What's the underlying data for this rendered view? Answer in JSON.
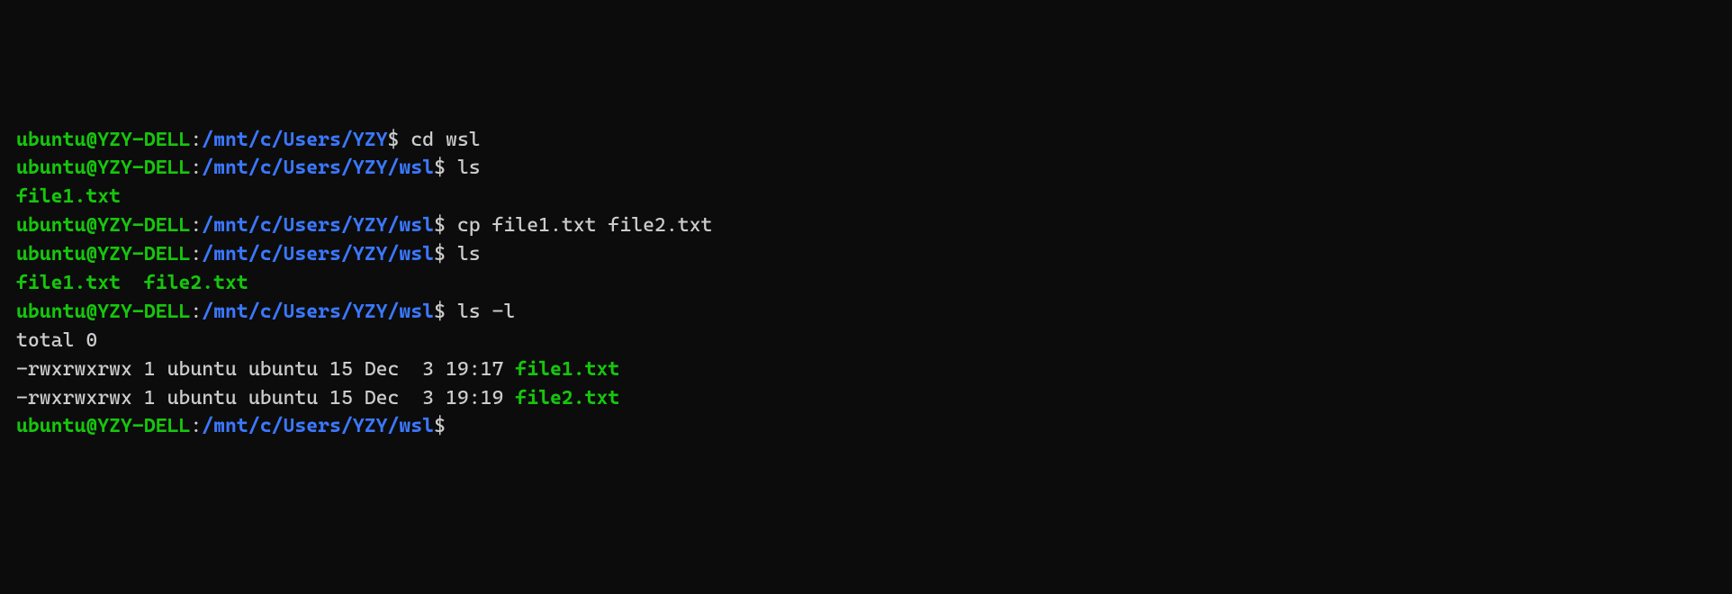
{
  "terminal": {
    "lines": [
      {
        "segments": [
          {
            "cls": "user-host",
            "text": "ubuntu@YZY-DELL"
          },
          {
            "cls": "plain",
            "text": ":"
          },
          {
            "cls": "path",
            "text": "/mnt/c/Users/YZY"
          },
          {
            "cls": "prompt-symbol",
            "text": "$ "
          },
          {
            "cls": "cmd",
            "text": "cd wsl"
          }
        ]
      },
      {
        "segments": [
          {
            "cls": "user-host",
            "text": "ubuntu@YZY-DELL"
          },
          {
            "cls": "plain",
            "text": ":"
          },
          {
            "cls": "path",
            "text": "/mnt/c/Users/YZY/wsl"
          },
          {
            "cls": "prompt-symbol",
            "text": "$ "
          },
          {
            "cls": "cmd",
            "text": "ls"
          }
        ]
      },
      {
        "segments": [
          {
            "cls": "file-green",
            "text": "file1.txt"
          }
        ]
      },
      {
        "segments": [
          {
            "cls": "user-host",
            "text": "ubuntu@YZY-DELL"
          },
          {
            "cls": "plain",
            "text": ":"
          },
          {
            "cls": "path",
            "text": "/mnt/c/Users/YZY/wsl"
          },
          {
            "cls": "prompt-symbol",
            "text": "$ "
          },
          {
            "cls": "cmd",
            "text": "cp file1.txt file2.txt"
          }
        ]
      },
      {
        "segments": [
          {
            "cls": "user-host",
            "text": "ubuntu@YZY-DELL"
          },
          {
            "cls": "plain",
            "text": ":"
          },
          {
            "cls": "path",
            "text": "/mnt/c/Users/YZY/wsl"
          },
          {
            "cls": "prompt-symbol",
            "text": "$ "
          },
          {
            "cls": "cmd",
            "text": "ls"
          }
        ]
      },
      {
        "segments": [
          {
            "cls": "file-green",
            "text": "file1.txt"
          },
          {
            "cls": "plain",
            "text": "  "
          },
          {
            "cls": "file-green",
            "text": "file2.txt"
          }
        ]
      },
      {
        "segments": [
          {
            "cls": "user-host",
            "text": "ubuntu@YZY-DELL"
          },
          {
            "cls": "plain",
            "text": ":"
          },
          {
            "cls": "path",
            "text": "/mnt/c/Users/YZY/wsl"
          },
          {
            "cls": "prompt-symbol",
            "text": "$ "
          },
          {
            "cls": "cmd",
            "text": "ls -l"
          }
        ]
      },
      {
        "segments": [
          {
            "cls": "plain",
            "text": "total 0"
          }
        ]
      },
      {
        "segments": [
          {
            "cls": "plain",
            "text": "-rwxrwxrwx 1 ubuntu ubuntu 15 Dec  3 19:17 "
          },
          {
            "cls": "file-green",
            "text": "file1.txt"
          }
        ]
      },
      {
        "segments": [
          {
            "cls": "plain",
            "text": "-rwxrwxrwx 1 ubuntu ubuntu 15 Dec  3 19:19 "
          },
          {
            "cls": "file-green",
            "text": "file2.txt"
          }
        ]
      },
      {
        "segments": [
          {
            "cls": "user-host",
            "text": "ubuntu@YZY-DELL"
          },
          {
            "cls": "plain",
            "text": ":"
          },
          {
            "cls": "path",
            "text": "/mnt/c/Users/YZY/wsl"
          },
          {
            "cls": "prompt-symbol",
            "text": "$ "
          }
        ]
      }
    ]
  }
}
